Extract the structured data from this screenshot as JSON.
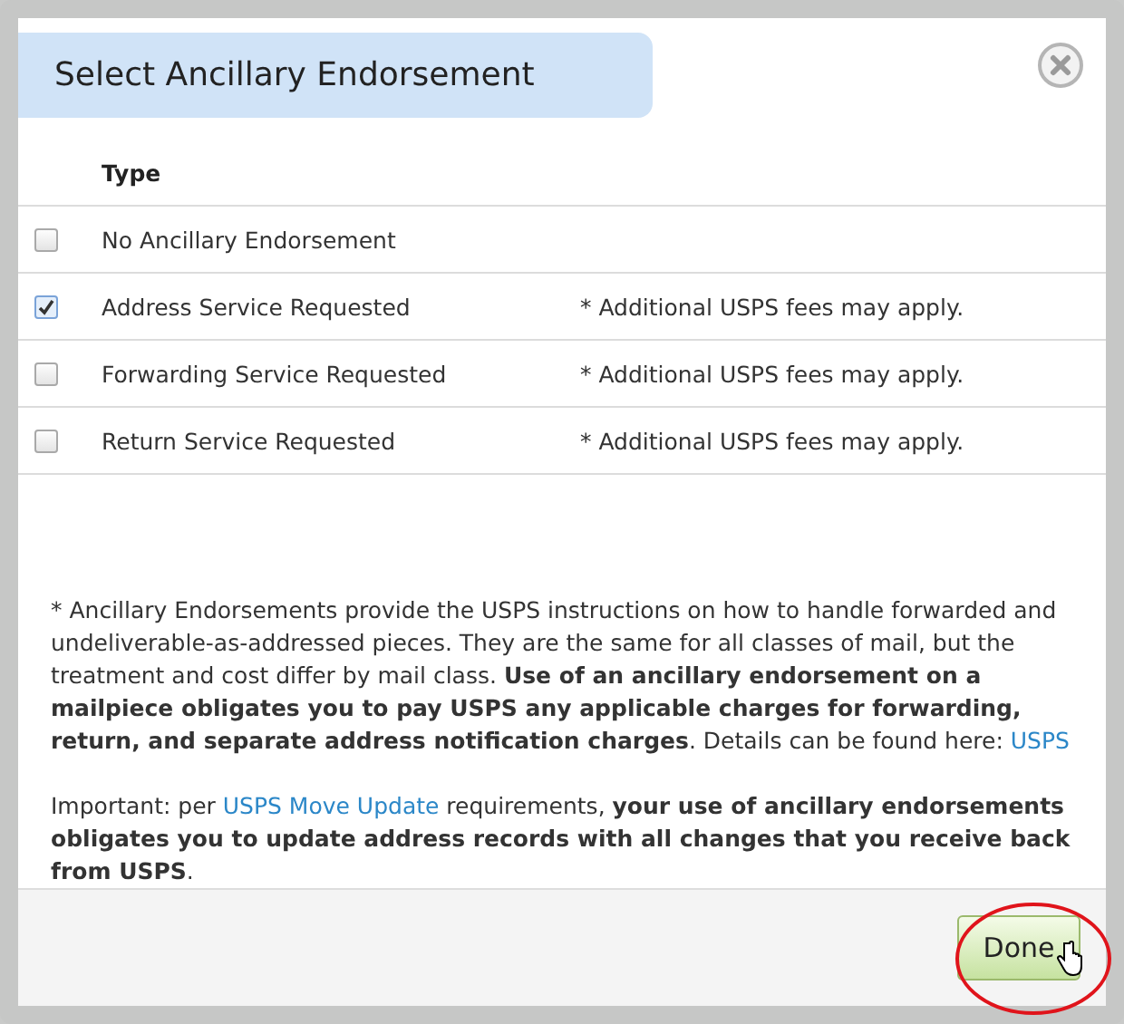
{
  "dialog": {
    "title": "Select Ancillary Endorsement"
  },
  "table": {
    "columns": [
      "Type"
    ],
    "rows": [
      {
        "type": "No Ancillary Endorsement",
        "checked": false
      },
      {
        "type": "Address Service Requested",
        "note": "* Additional USPS fees may apply.",
        "checked": true
      },
      {
        "type": "Forwarding Service Requested",
        "note": "* Additional USPS fees may apply.",
        "checked": false
      },
      {
        "type": "Return Service Requested",
        "note": "* Additional USPS fees may apply.",
        "checked": false
      }
    ]
  },
  "paragraphs": [
    [
      {
        "kind": "text",
        "text": "* Ancillary Endorsements provide the USPS instructions on how to handle forwarded and undeliverable-as-addressed pieces. They are the same for all classes of mail, but the treatment and cost differ by mail class. **Use of an ancillary endorsement on a mailpiece obligates you to pay USPS any applicable charges for forwarding, return, and separate address notification charges**. Details can be found here: "
      },
      {
        "kind": "link",
        "text": "USPS"
      }
    ],
    [
      {
        "kind": "text",
        "text": "Important: per "
      },
      {
        "kind": "link",
        "text": "USPS Move Update"
      },
      {
        "kind": "text",
        "text": " requirements, **your use of ancillary endorsements obligates you to update address records with all changes that you receive back from USPS**."
      }
    ]
  ],
  "footer": {
    "button": "Done"
  }
}
